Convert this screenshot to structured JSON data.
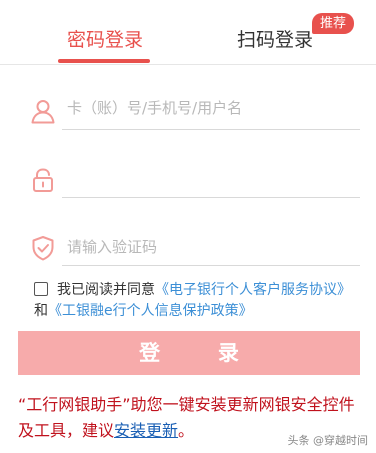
{
  "tabs": {
    "password_login": "密码登录",
    "scan_login": "扫码登录",
    "recommend_badge": "推荐"
  },
  "form": {
    "account_placeholder": "卡（账）号/手机号/用户名",
    "password_placeholder": "",
    "captcha_placeholder": "请输入验证码"
  },
  "agreement": {
    "prefix": "我已阅读并同意",
    "link1": "《电子银行个人客户服务协议》",
    "and": "和",
    "link2": "《工银融e行个人信息保护政策》"
  },
  "login_button": "登 录",
  "promo": {
    "text": "“工行网银助手”助您一键安装更新网银安全控件及工具，建议",
    "link": "安装更新",
    "suffix": "。"
  },
  "watermark": "头条 @穿越时间",
  "colors": {
    "accent": "#e8514d",
    "button_bg": "#f7abab",
    "link_blue": "#3c8fd6",
    "promo_red": "#c0121d"
  },
  "icons": [
    "user-icon",
    "lock-icon",
    "shield-check-icon"
  ]
}
